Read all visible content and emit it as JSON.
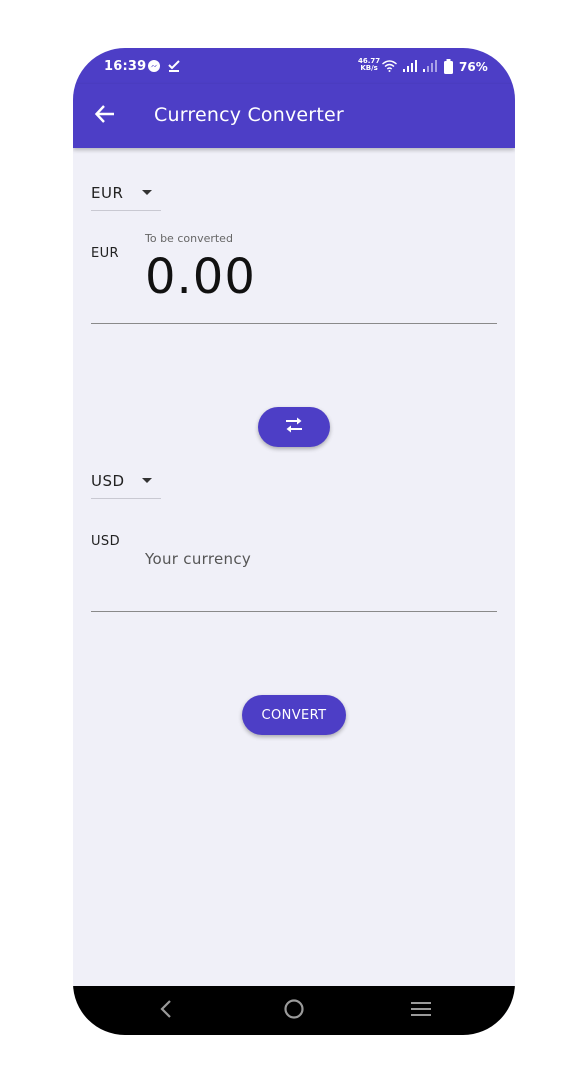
{
  "status_bar": {
    "time": "16:39",
    "net_speed_value": "46.77",
    "net_speed_unit": "KB/s",
    "battery": "76%",
    "icons": [
      "messenger-icon",
      "task-check-icon",
      "wifi-icon",
      "signal-icon",
      "signal-weak-icon",
      "battery-icon"
    ]
  },
  "app_bar": {
    "title": "Currency Converter",
    "back_icon": "arrow-left-icon"
  },
  "from": {
    "selected_currency": "EUR",
    "code_label": "EUR",
    "field_label": "To be converted",
    "value": "0.00"
  },
  "swap": {
    "icon": "swap-arrows-icon"
  },
  "to": {
    "selected_currency": "USD",
    "code_label": "USD",
    "placeholder": "Your currency"
  },
  "convert_button": {
    "label": "CONVERT"
  },
  "nav_bar": {
    "icons": [
      "back-triangle-icon",
      "home-circle-icon",
      "recents-icon"
    ]
  },
  "colors": {
    "primary": "#4d3ec6",
    "background": "#f0f0f8",
    "nav_bar": "#000000"
  }
}
